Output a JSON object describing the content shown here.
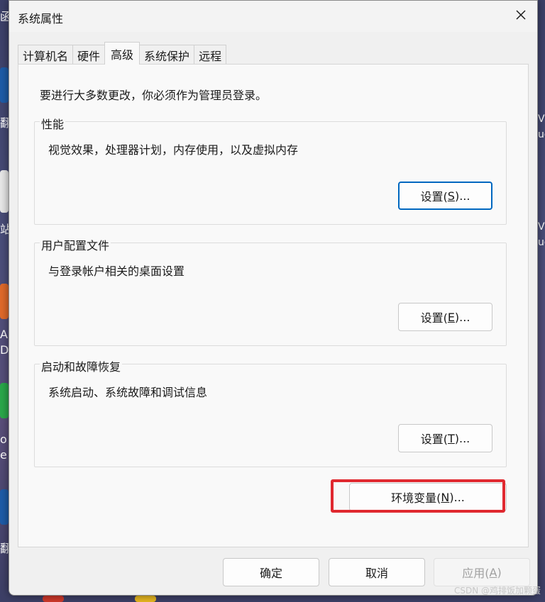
{
  "window": {
    "title": "系统属性",
    "close_glyph": "✕"
  },
  "tabs": [
    {
      "label": "计算机名",
      "active": false
    },
    {
      "label": "硬件",
      "active": false
    },
    {
      "label": "高级",
      "active": true
    },
    {
      "label": "系统保护",
      "active": false
    },
    {
      "label": "远程",
      "active": false
    }
  ],
  "advanced": {
    "intro": "要进行大多数更改，你必须作为管理员登录。",
    "performance": {
      "legend": "性能",
      "desc": "视觉效果，处理器计划，内存使用，以及虚拟内存",
      "button": {
        "text": "设置(",
        "key": "S",
        "rest": ")..."
      }
    },
    "profiles": {
      "legend": "用户配置文件",
      "desc": "与登录帐户相关的桌面设置",
      "button": {
        "text": "设置(",
        "key": "E",
        "rest": ")..."
      }
    },
    "startup": {
      "legend": "启动和故障恢复",
      "desc": "系统启动、系统故障和调试信息",
      "button": {
        "text": "设置(",
        "key": "T",
        "rest": ")..."
      }
    },
    "env_button": {
      "text": "环境变量(",
      "key": "N",
      "rest": ")..."
    }
  },
  "footer": {
    "ok": "确定",
    "cancel": "取消",
    "apply": {
      "text": "应用(",
      "key": "A",
      "rest": ")"
    }
  },
  "watermark": "CSDN @鸡排饭加颗蛋",
  "desktop_fragments": [
    "函",
    "翻",
    "站",
    "A",
    "Da",
    "o",
    "e",
    "翻",
    "V",
    "uo",
    "V",
    "uo"
  ],
  "colors": {
    "accent": "#0067c0",
    "highlight_box": "#e0282f"
  }
}
